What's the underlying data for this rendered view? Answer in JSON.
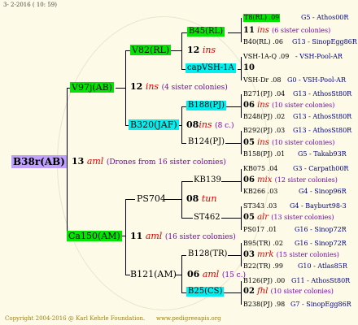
{
  "header": {
    "date": "3-  2-2016 ( 10: 59)"
  },
  "footer": {
    "copyright": "Copyright 2004-2016 @ Karl Kehrle Foundation.",
    "url": "www.pedigreeapis.org"
  },
  "root": {
    "label": "B38r(AB)"
  },
  "gen1": {
    "top": {
      "label": "V97j(AB)"
    },
    "bottom": {
      "label": "Ca150(AM)"
    },
    "mid_num": "13",
    "mid_race": "aml",
    "mid_note": "(Drones from 16 sister colonies)"
  },
  "gen2": {
    "v82": {
      "label": "V82(RL)",
      "num": "12",
      "race": "ins"
    },
    "v97_num": "12",
    "v97_race": "ins",
    "v97_note": "(4 sister colonies)",
    "b320": {
      "label": "B320(JAF)",
      "num": "08",
      "race": "ins",
      "note": "(8 c.)"
    },
    "ps704": {
      "label": "PS704",
      "num": "08",
      "race": "tun"
    },
    "ca150_num": "11",
    "ca150_race": "aml",
    "ca150_note": "(16 sister colonies)",
    "b121": {
      "label": "B121(AM)",
      "num": "06",
      "race": "aml",
      "note": "(15 c.)"
    }
  },
  "gen3": {
    "b45": {
      "label": "B45(RL)",
      "num": "11",
      "race": "ins",
      "note": "(6 sister colonies)"
    },
    "capvsh": {
      "label": "capVSH-1A",
      "num": "10"
    },
    "b188": {
      "label": "B188(PJ)",
      "num": "06",
      "race": "ins",
      "note": "(10 sister colonies)"
    },
    "b124": {
      "label": "B124(PJ)",
      "num": "05",
      "race": "ins",
      "note": "(10 sister colonies)"
    },
    "kb139": {
      "label": "KB139",
      "num": "06",
      "race": "mix",
      "note": "(12 sister colonies)"
    },
    "st462": {
      "label": "ST462",
      "num": "05",
      "race": "alr",
      "note": "(13 sister colonies)"
    },
    "b128": {
      "label": "B128(TR)",
      "num": "03",
      "race": "mrk",
      "note": "(15 sister colonies)"
    },
    "b25": {
      "label": "B25(CS)",
      "num": "02",
      "race": "fhl",
      "note": "(10 sister colonies)"
    }
  },
  "gen4": [
    {
      "label": "T8(RL) .09",
      "src": "G5 - Athos00R"
    },
    {
      "label": "B40(RL) .06",
      "src": "G13 - SinopEgg86R"
    },
    {
      "label": "VSH-1A-Q .09",
      "src": "- VSH-Pool-AR"
    },
    {
      "label": "VSH-Dr .08",
      "src": "G0 - VSH-Pool-AR"
    },
    {
      "label": "B271(PJ) .04",
      "src": "G13 - AthosSt80R"
    },
    {
      "label": "B248(PJ) .02",
      "src": "G13 - AthosSt80R"
    },
    {
      "label": "B292(PJ) .03",
      "src": "G13 - AthosSt80R"
    },
    {
      "label": "B158(PJ) .01",
      "src": "G5 - Takab93R"
    },
    {
      "label": "KB075 .04",
      "src": "G3 - Carpath00R"
    },
    {
      "label": "KB266 .03",
      "src": "G4 - Sinop96R"
    },
    {
      "label": "ST343 .03",
      "src": "G4 - Bayburt98-3"
    },
    {
      "label": "PS017 .01",
      "src": "G16 - Sinop72R"
    },
    {
      "label": "B95(TR) .02",
      "src": "G16 - Sinop72R"
    },
    {
      "label": "B22(TR) .99",
      "src": "G10 - Atlas85R"
    },
    {
      "label": "B126(PJ) .00",
      "src": "G11 - AthosSt80R"
    },
    {
      "label": "B238(PJ) .98",
      "src": "G7 - SinopEgg86R"
    }
  ]
}
